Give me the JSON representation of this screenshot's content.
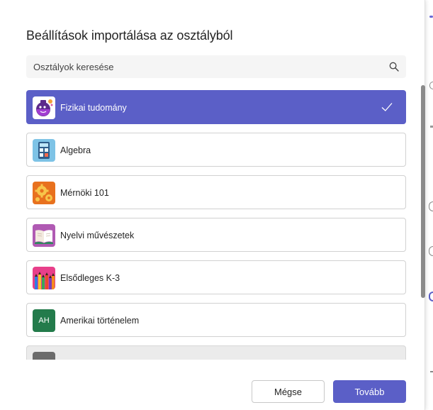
{
  "dialog": {
    "title": "Beállítások importálása az osztályból",
    "search": {
      "placeholder": "Osztályok keresése",
      "value": ""
    },
    "classes": [
      {
        "label": "Fizikai tudomány",
        "icon": "science-flask-icon",
        "selected": true
      },
      {
        "label": "Algebra",
        "icon": "calculator-icon",
        "selected": false
      },
      {
        "label": "Mérnöki 101",
        "icon": "gears-icon",
        "selected": false
      },
      {
        "label": "Nyelvi művészetek",
        "icon": "open-book-icon",
        "selected": false
      },
      {
        "label": "Elsődleges K-3",
        "icon": "colored-pencils-icon",
        "selected": false
      },
      {
        "label": "Amerikai történelem",
        "icon": "initials-avatar",
        "initials": "AH",
        "selected": false
      },
      {
        "label": "",
        "icon": "class-icon",
        "selected": false
      }
    ],
    "buttons": {
      "cancel": "Mégse",
      "next": "Tovább"
    }
  },
  "colors": {
    "accent": "#5b5fc7",
    "card_border": "#d1d1d1",
    "search_bg": "#f5f5f5",
    "avatar_green": "#237b4b"
  }
}
